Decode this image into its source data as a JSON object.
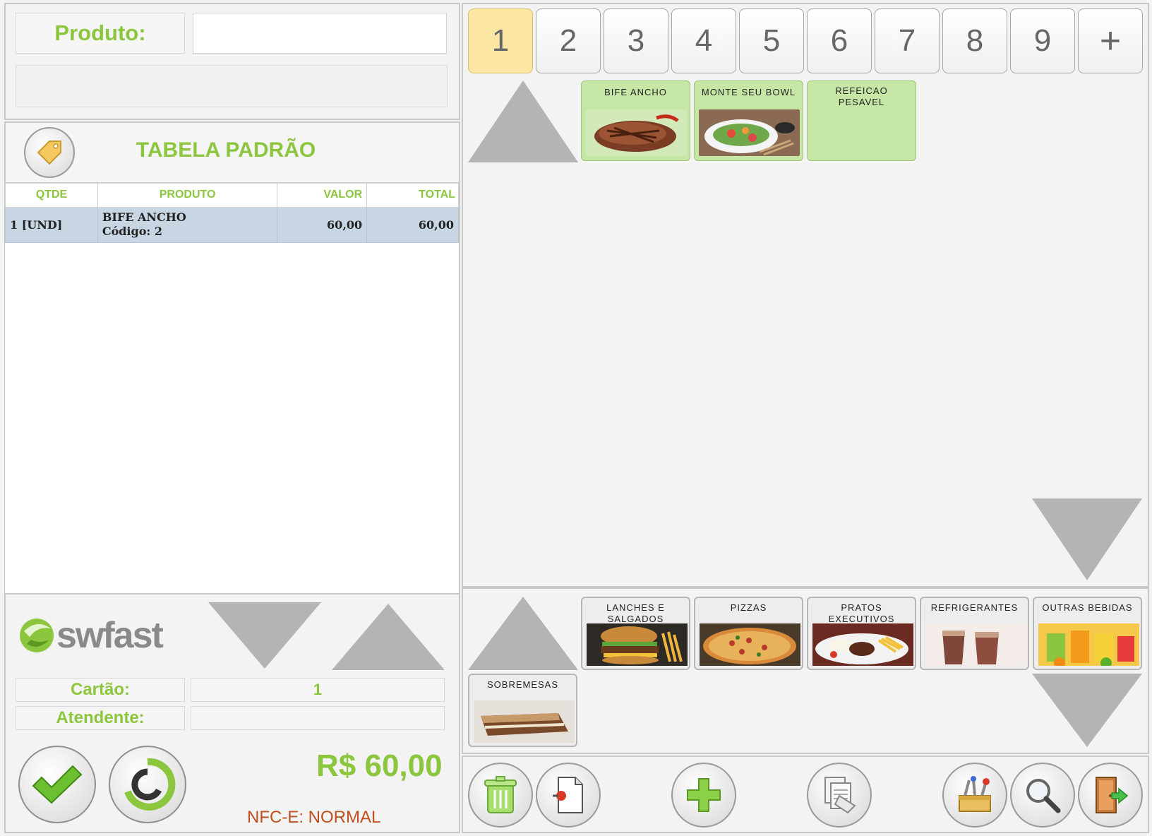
{
  "search": {
    "label": "Produto:",
    "value": "",
    "description": ""
  },
  "order": {
    "table_name": "TABELA PADRÃO",
    "columns": [
      "QTDE",
      "PRODUTO",
      "VALOR",
      "TOTAL"
    ],
    "rows": [
      {
        "qty": "1 [UND]",
        "product": "BIFE ANCHO",
        "code": "Código: 2",
        "value": "60,00",
        "total": "60,00"
      }
    ]
  },
  "footer": {
    "logo": "swfast",
    "card_label": "Cartão:",
    "card_value": "1",
    "attendant_label": "Atendente:",
    "attendant_value": "",
    "total": "R$ 60,00",
    "nfce_status": "NFC-E: NORMAL"
  },
  "pages": [
    "1",
    "2",
    "3",
    "4",
    "5",
    "6",
    "7",
    "8",
    "9",
    "+"
  ],
  "products": [
    {
      "name": "BIFE ANCHO"
    },
    {
      "name": "MONTE SEU BOWL"
    },
    {
      "name": "REFEICAO PESAVEL"
    }
  ],
  "categories": [
    {
      "name": "LANCHES E SALGADOS"
    },
    {
      "name": "PIZZAS"
    },
    {
      "name": "PRATOS EXECUTIVOS"
    },
    {
      "name": "REFRIGERANTES"
    },
    {
      "name": "OUTRAS BEBIDAS"
    },
    {
      "name": "SOBREMESAS"
    }
  ],
  "colors": {
    "accent": "#8cc63e",
    "selected_row": "#c8d6e4",
    "active_page": "#fbe7a3",
    "product_tile": "#c6e6a6",
    "nfce": "#c0501e"
  },
  "toolbar_icons": [
    "trash-icon",
    "document-pin-icon",
    "plus-icon",
    "copy-documents-icon",
    "tools-icon",
    "search-icon",
    "exit-door-icon"
  ]
}
